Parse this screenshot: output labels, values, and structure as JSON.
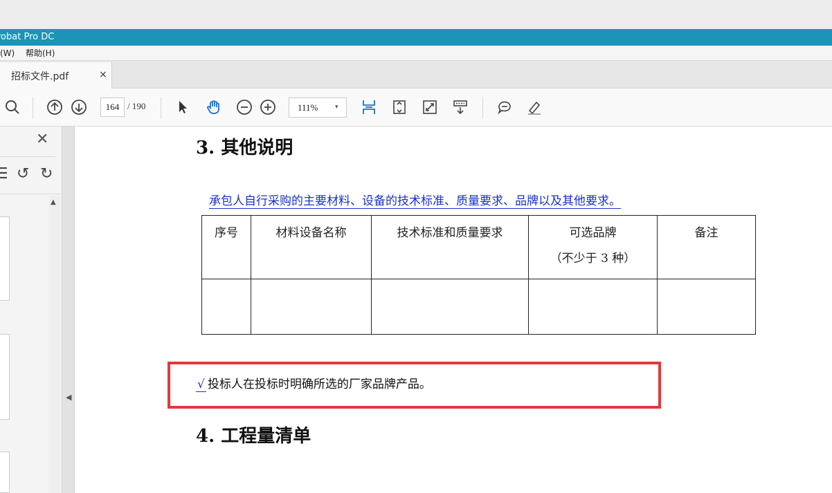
{
  "app": {
    "title_partial": "robat Pro DC"
  },
  "menu": {
    "window_partial": "(W)",
    "help": "帮助(H)"
  },
  "tab": {
    "title": "招标文件.pdf",
    "close": "×"
  },
  "toolbar": {
    "page_current": "164",
    "page_total": "/ 190",
    "zoom": "111%",
    "zoom_caret": "▾"
  },
  "left_panel": {
    "close": "✕",
    "scroll_up": "▲",
    "collapse_arrow": "◀"
  },
  "document": {
    "section3_heading": "3.  其他说明",
    "requirement_link": "承包人自行采购的主要材料、设备的技术标准、质量要求、品牌以及其他要求。",
    "table": {
      "headers": [
        "序号",
        "材料设备名称",
        "技术标准和质量要求",
        "可选品牌",
        "备注"
      ],
      "header_brand_sub": "（不少于 3 种）"
    },
    "checkmark": "√",
    "highlighted_note": "投标人在投标时明确所选的厂家品牌产品。",
    "section4_heading": "4.  工程量清单",
    "highlight_color": "#e8373a",
    "link_color": "#1a31c8"
  }
}
